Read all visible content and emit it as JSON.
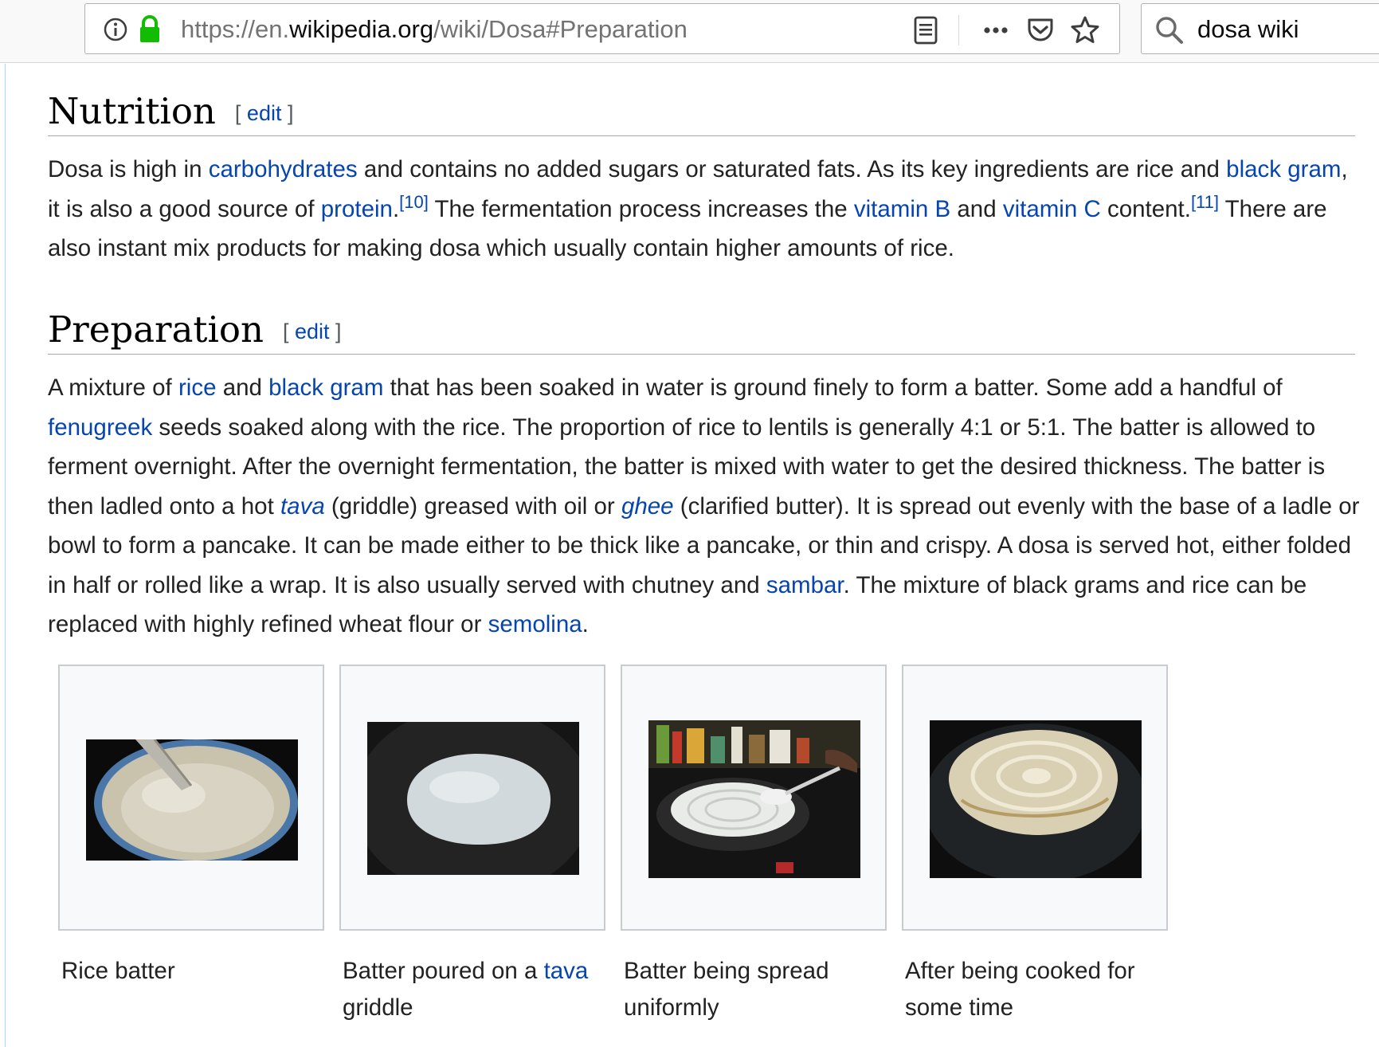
{
  "browser": {
    "url_prefix": "https://en.",
    "url_domain": "wikipedia.org",
    "url_path": "/wiki/Dosa#Preparation",
    "search_value": "dosa wiki"
  },
  "icons": [
    "info-icon",
    "lock-icon",
    "reader-view-icon",
    "more-actions-icon",
    "pocket-icon",
    "bookmark-star-icon",
    "search-icon"
  ],
  "colors": {
    "link": "#0645ad",
    "text": "#222222",
    "lock": "#12bc00",
    "rule": "#a2a9b1"
  },
  "nutrition": {
    "heading": "Nutrition",
    "edit_label": "edit",
    "segments": [
      {
        "t": "Dosa is high in "
      },
      {
        "t": "carbohydrates",
        "link": true
      },
      {
        "t": " and contains no added sugars or saturated fats. As its key ingredients are rice and "
      },
      {
        "t": "black gram",
        "link": true
      },
      {
        "t": ", it is also a good source of "
      },
      {
        "t": "protein",
        "link": true
      },
      {
        "t": "."
      },
      {
        "t": "[10]",
        "link": true,
        "sup": true
      },
      {
        "t": " The fermentation process increases the "
      },
      {
        "t": "vitamin B",
        "link": true
      },
      {
        "t": " and "
      },
      {
        "t": "vitamin C",
        "link": true
      },
      {
        "t": " content."
      },
      {
        "t": "[11]",
        "link": true,
        "sup": true
      },
      {
        "t": " There are also instant mix products for making dosa which usually contain higher amounts of rice."
      }
    ]
  },
  "preparation": {
    "heading": "Preparation",
    "edit_label": "edit",
    "segments": [
      {
        "t": "A mixture of "
      },
      {
        "t": "rice",
        "link": true
      },
      {
        "t": " and "
      },
      {
        "t": "black gram",
        "link": true
      },
      {
        "t": " that has been soaked in water is ground finely to form a batter. Some add a handful of "
      },
      {
        "t": "fenugreek",
        "link": true
      },
      {
        "t": " seeds soaked along with the rice. The proportion of rice to lentils is generally 4:1 or 5:1. The batter is allowed to ferment overnight. After the overnight fermentation, the batter is mixed with water to get the desired thickness. The batter is then ladled onto a hot "
      },
      {
        "t": "tava",
        "link": true,
        "italic": true
      },
      {
        "t": " (griddle) greased with oil or "
      },
      {
        "t": "ghee",
        "link": true,
        "italic": true
      },
      {
        "t": " (clarified butter). It is spread out evenly with the base of a ladle or bowl to form a pancake. It can be made either to be thick like a pancake, or thin and crispy. A dosa is served hot, either folded in half or rolled like a wrap. It is also usually served with chutney and "
      },
      {
        "t": "sambar",
        "link": true
      },
      {
        "t": ". The mixture of black grams and rice can be replaced with highly refined wheat flour or "
      },
      {
        "t": "semolina",
        "link": true
      },
      {
        "t": "."
      }
    ]
  },
  "gallery": [
    {
      "caption": [
        {
          "t": "Rice batter"
        }
      ]
    },
    {
      "caption": [
        {
          "t": "Batter poured on a "
        },
        {
          "t": "tava",
          "link": true
        },
        {
          "t": " griddle"
        }
      ]
    },
    {
      "caption": [
        {
          "t": "Batter being spread uniformly"
        }
      ]
    },
    {
      "caption": [
        {
          "t": "After being cooked for some time"
        }
      ]
    }
  ]
}
